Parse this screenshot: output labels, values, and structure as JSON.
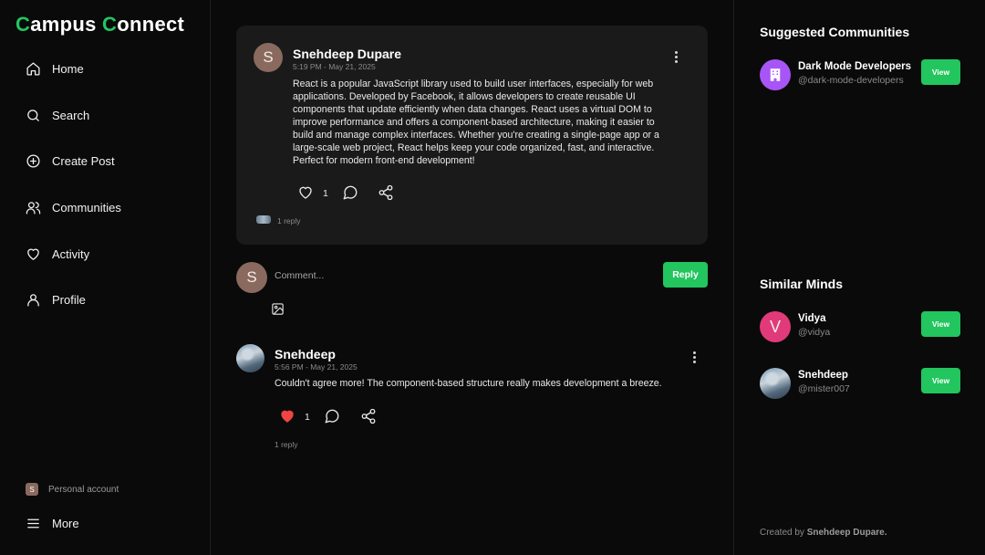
{
  "app": {
    "logo_c1": "C",
    "logo_p1": "ampus ",
    "logo_c2": "C",
    "logo_p2": "onnect",
    "accent_color": "#22c55e"
  },
  "nav": {
    "home": "Home",
    "search": "Search",
    "create_post": "Create Post",
    "communities": "Communities",
    "activity": "Activity",
    "profile": "Profile",
    "account_initial": "S",
    "account_label": "Personal account",
    "more": "More"
  },
  "post": {
    "avatar_initial": "S",
    "author": "Snehdeep Dupare",
    "time": "5:19 PM - May 21, 2025",
    "text": "React is a popular JavaScript library used to build user interfaces, especially for web applications. Developed by Facebook, it allows developers to create reusable UI components that update efficiently when data changes. React uses a virtual DOM to improve performance and offers a component-based architecture, making it easier to build and manage complex interfaces. Whether you're creating a single-page app or a large-scale web project, React helps keep your code organized, fast, and interactive. Perfect for modern front-end development!",
    "likes": "1",
    "liked": false,
    "replies": "1 reply"
  },
  "composer": {
    "avatar_initial": "S",
    "placeholder": "Comment...",
    "reply_label": "Reply"
  },
  "comment": {
    "author": "Snehdeep",
    "time": "5:56 PM - May 21, 2025",
    "text": "Couldn't agree more! The component-based structure really makes development a breeze.",
    "likes": "1",
    "liked": true,
    "like_color": "#ef4444",
    "replies": "1 reply"
  },
  "right": {
    "suggested_title": "Suggested Communities",
    "communities": [
      {
        "name": "Dark Mode Developers",
        "handle": "@dark-mode-developers",
        "icon": "building-icon",
        "color": "#a855f7",
        "view_label": "View"
      }
    ],
    "similar_title": "Similar Minds",
    "users": [
      {
        "initial": "V",
        "name": "Vidya",
        "handle": "@vidya",
        "color": "#e13a7a",
        "view_label": "View"
      },
      {
        "initial": "",
        "name": "Snehdeep",
        "handle": "@mister007",
        "view_label": "View"
      }
    ],
    "footer_prefix": "Created by",
    "footer_name": "Snehdeep Dupare."
  }
}
